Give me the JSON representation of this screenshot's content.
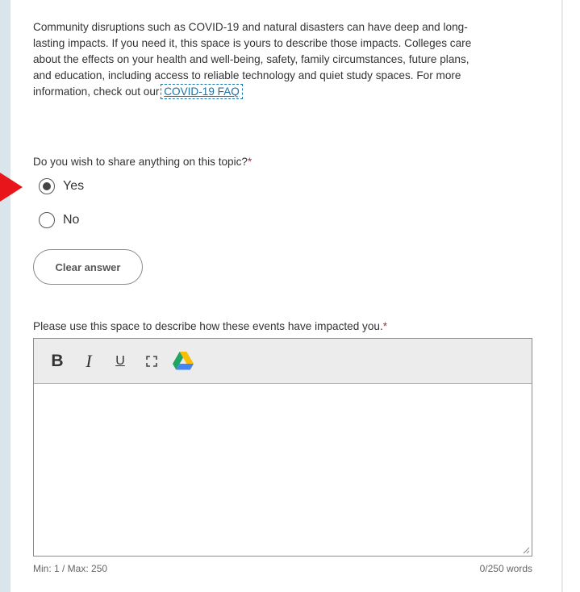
{
  "intro": {
    "text": "Community disruptions such as COVID-19 and natural disasters can have deep and long-lasting impacts. If you need it, this space is yours to describe those impacts. Colleges care about the effects on your health and well-being, safety, family circumstances, future plans, and education, including access to reliable technology and quiet study spaces. For more information, check out our",
    "link_label": "COVID-19 FAQ"
  },
  "question": {
    "label": "Do you wish to share anything on this topic?",
    "required_mark": "*",
    "options": [
      {
        "label": "Yes",
        "selected": true
      },
      {
        "label": "No",
        "selected": false
      }
    ],
    "clear_label": "Clear answer"
  },
  "essay": {
    "prompt": "Please use this space to describe how these events have impacted you.",
    "required_mark": "*",
    "toolbar": {
      "bold": "B",
      "italic": "I",
      "underline": "U",
      "fullscreen_icon": "fullscreen-icon",
      "drive_icon": "google-drive-icon"
    },
    "value": "",
    "limits": "Min: 1 / Max: 250",
    "count": "0/250 words"
  },
  "colors": {
    "required": "#c8202b",
    "link": "#1a73a8",
    "pointer_arrow": "#e8161a",
    "side_strip": "#d9e5ea"
  }
}
